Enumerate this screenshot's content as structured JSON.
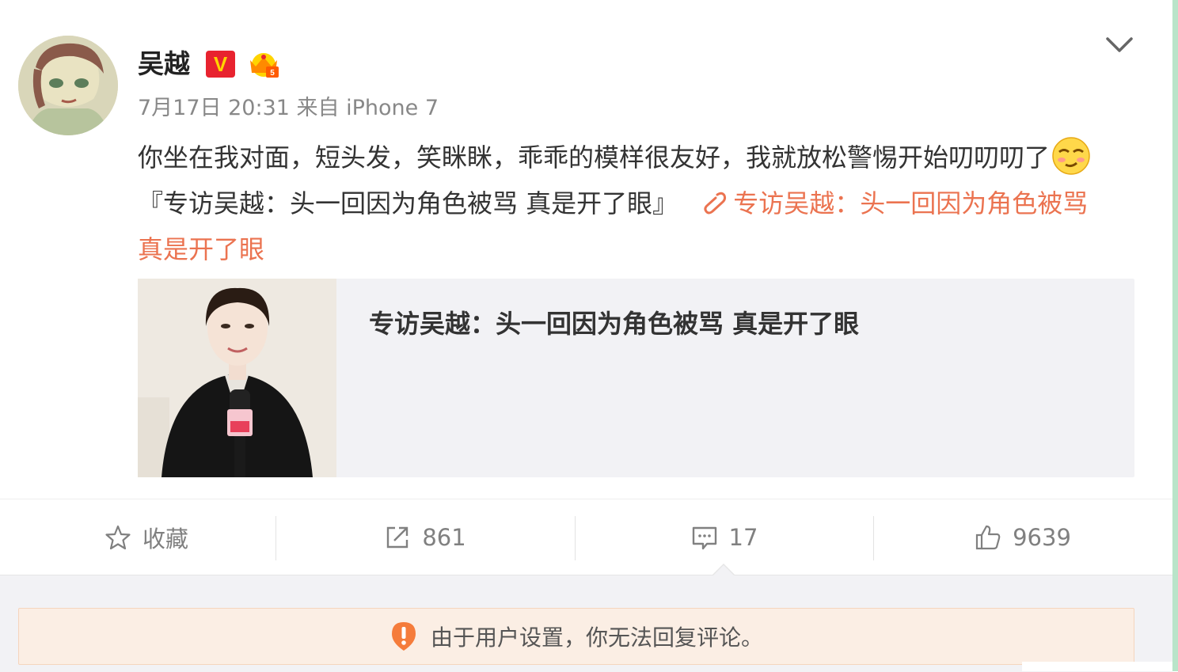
{
  "post": {
    "author": "吴越",
    "verified_badge": "V",
    "member_badge_icon": "crown-member-icon",
    "timestamp": "7月17日 20:31",
    "source": "来自 iPhone 7",
    "text_part1": "你坐在我对面，短头发，笑眯眯，乖乖的模样很友好，我就放松警惕开始叨叨叨了",
    "emoji": "smirk-emoji-icon",
    "text_part2": "『专访吴越：头一回因为角色被骂 真是开了眼』",
    "link_text": "专访吴越：头一回因为角色被骂 真是开了眼"
  },
  "preview_card": {
    "title": "专访吴越：头一回因为角色被骂 真是开了眼"
  },
  "actions": {
    "favorite_label": "收藏",
    "repost_count": "861",
    "comment_count": "17",
    "like_count": "9639"
  },
  "notice": {
    "text": "由于用户设置，你无法回复评论。"
  },
  "colors": {
    "link": "#eb7350",
    "verified_bg": "#e8232f",
    "notice_bg": "#fbeee4",
    "warning": "#f57c3b"
  }
}
